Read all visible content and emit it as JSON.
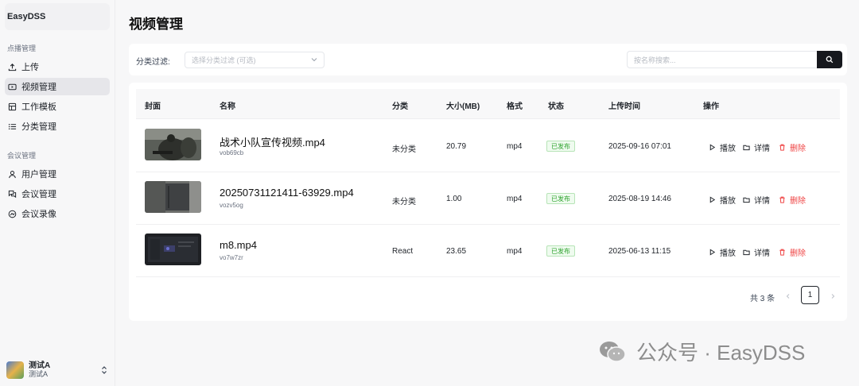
{
  "sidebar": {
    "brand": "EasyDSS",
    "groups": [
      {
        "label": "点播管理",
        "items": [
          {
            "label": "上传",
            "icon": "upload-icon"
          },
          {
            "label": "视频管理",
            "icon": "video-icon",
            "active": true
          },
          {
            "label": "工作模板",
            "icon": "template-icon"
          },
          {
            "label": "分类管理",
            "icon": "list-icon"
          }
        ]
      },
      {
        "label": "会议管理",
        "items": [
          {
            "label": "用户管理",
            "icon": "user-icon"
          },
          {
            "label": "会议管理",
            "icon": "meeting-icon"
          },
          {
            "label": "会议录像",
            "icon": "record-icon"
          }
        ]
      }
    ],
    "user": {
      "name": "测试A",
      "sub": "测试A"
    }
  },
  "page": {
    "title": "视频管理"
  },
  "filter": {
    "label": "分类过滤:",
    "select_placeholder": "选择分类过滤 (可选)",
    "search_placeholder": "按名称搜索..."
  },
  "table": {
    "headers": [
      "封面",
      "名称",
      "分类",
      "大小(MB)",
      "格式",
      "状态",
      "上传时间",
      "操作"
    ],
    "rows": [
      {
        "name": "战术小队宣传视频.mp4",
        "id": "vob69cb",
        "category": "未分类",
        "size": "20.79",
        "format": "mp4",
        "status": "已发布",
        "time": "2025-09-16 07:01"
      },
      {
        "name": "20250731121411-63929.mp4",
        "id": "vozv5og",
        "category": "未分类",
        "size": "1.00",
        "format": "mp4",
        "status": "已发布",
        "time": "2025-08-19 14:46"
      },
      {
        "name": "m8.mp4",
        "id": "vo7w7zr",
        "category": "React",
        "size": "23.65",
        "format": "mp4",
        "status": "已发布",
        "time": "2025-06-13 11:15"
      }
    ],
    "actions": {
      "play": "播放",
      "detail": "详情",
      "delete": "删除"
    }
  },
  "pager": {
    "total": "共 3 条",
    "current": "1"
  },
  "watermark": {
    "text": "公众号 · EasyDSS"
  },
  "colors": {
    "status_green": "#2fa32f",
    "delete_red": "#ef4444",
    "search_button": "#16181d"
  }
}
